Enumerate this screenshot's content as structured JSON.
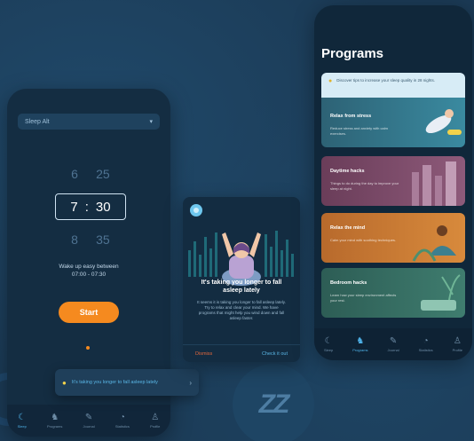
{
  "alarm": {
    "select_value": "Sleep Alt",
    "hours_above": "6",
    "minutes_above": "25",
    "hour": "7",
    "separator": ":",
    "minute": "30",
    "hours_below": "8",
    "minutes_below": "35",
    "wake_line1": "Wake up easy between",
    "wake_line2": "07:00 - 07:30",
    "start_label": "Start"
  },
  "tip": {
    "text": "It's taking you longer to fall asleep lately"
  },
  "popup": {
    "title": "It's taking you longer to fall asleep lately",
    "body": "It seems it is taking you longer to fall asleep lately. Try to relax and clear your mind. We have programs that might help you wind down and fall asleep faster.",
    "dismiss_label": "Dismiss",
    "check_label": "Check it out"
  },
  "programs": {
    "title": "Programs",
    "info": "Discover tips to increase your sleep quality in 28 nights.",
    "items": [
      {
        "title": "Relax from stress",
        "desc": "Reduce stress and anxiety with calm exercises."
      },
      {
        "title": "Daytime hacks",
        "desc": "Things to do during the day to improve your sleep at night."
      },
      {
        "title": "Relax the mind",
        "desc": "Calm your mind with soothing techniques."
      },
      {
        "title": "Bedroom hacks",
        "desc": "Learn how your sleep environment affects your rest."
      }
    ]
  },
  "tabs": [
    {
      "label": "Sleep",
      "icon": "moon-icon"
    },
    {
      "label": "Programs",
      "icon": "runner-icon"
    },
    {
      "label": "Journal",
      "icon": "journal-icon"
    },
    {
      "label": "Statistics",
      "icon": "chart-icon"
    },
    {
      "label": "Profile",
      "icon": "profile-icon"
    }
  ],
  "colors": {
    "accent": "#4fb3ea",
    "start_button": "#f58a1f",
    "background": "#1b3a55"
  }
}
